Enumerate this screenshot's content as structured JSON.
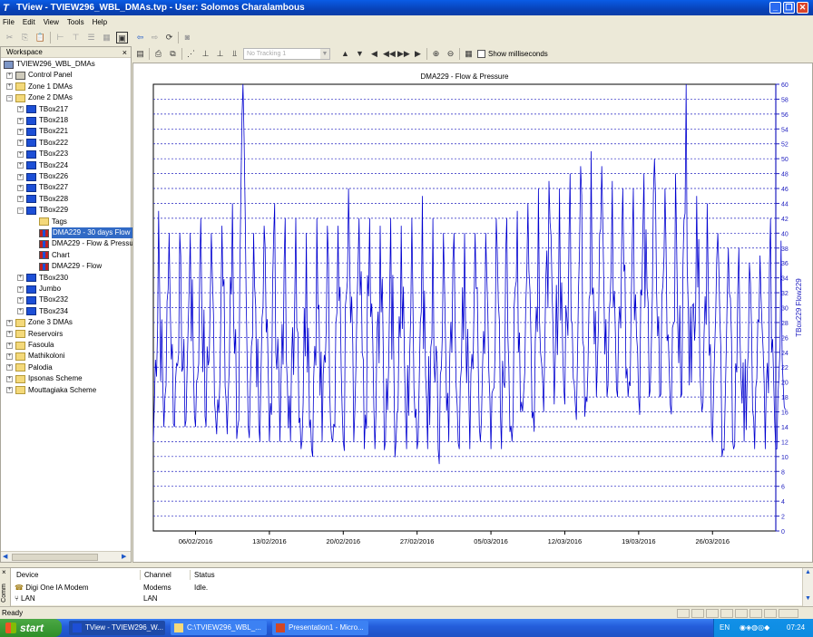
{
  "window": {
    "title": "TView - TVIEW296_WBL_DMAs.tvp - User: Solomos Charalambous",
    "app_icon": "T"
  },
  "menu": [
    "File",
    "Edit",
    "View",
    "Tools",
    "Help"
  ],
  "toolbar": {
    "tracking_placeholder": "No Tracking 1",
    "show_ms_label": "Show milliseconds"
  },
  "workspace": {
    "header": "Workspace",
    "close": "×",
    "tree": [
      {
        "label": "TVIEW296_WBL_DMAs",
        "level": 0,
        "icon": "root",
        "expander": ""
      },
      {
        "label": "Control Panel",
        "level": 1,
        "icon": "control",
        "expander": "+"
      },
      {
        "label": "Zone 1 DMAs",
        "level": 1,
        "icon": "folder",
        "expander": "+"
      },
      {
        "label": "Zone 2 DMAs",
        "level": 1,
        "icon": "folder",
        "expander": "−"
      },
      {
        "label": "TBox217",
        "level": 2,
        "icon": "tbox",
        "expander": "+"
      },
      {
        "label": "TBox218",
        "level": 2,
        "icon": "tbox",
        "expander": "+"
      },
      {
        "label": "TBox221",
        "level": 2,
        "icon": "tbox",
        "expander": "+"
      },
      {
        "label": "TBox222",
        "level": 2,
        "icon": "tbox",
        "expander": "+"
      },
      {
        "label": "TBox223",
        "level": 2,
        "icon": "tbox",
        "expander": "+"
      },
      {
        "label": "TBox224",
        "level": 2,
        "icon": "tbox",
        "expander": "+"
      },
      {
        "label": "TBox226",
        "level": 2,
        "icon": "tbox",
        "expander": "+"
      },
      {
        "label": "TBox227",
        "level": 2,
        "icon": "tbox",
        "expander": "+"
      },
      {
        "label": "TBox228",
        "level": 2,
        "icon": "tbox",
        "expander": "+"
      },
      {
        "label": "TBox229",
        "level": 2,
        "icon": "tbox",
        "expander": "−"
      },
      {
        "label": "Tags",
        "level": 3,
        "icon": "folder",
        "expander": ""
      },
      {
        "label": "DMA229 - 30 days Flow (",
        "level": 3,
        "icon": "chart",
        "expander": "",
        "selected": true
      },
      {
        "label": "DMA229 - Flow & Pressur",
        "level": 3,
        "icon": "chart",
        "expander": ""
      },
      {
        "label": "Chart",
        "level": 3,
        "icon": "chart",
        "expander": ""
      },
      {
        "label": "DMA229 - Flow",
        "level": 3,
        "icon": "chart",
        "expander": ""
      },
      {
        "label": "TBox230",
        "level": 2,
        "icon": "tbox",
        "expander": "+"
      },
      {
        "label": "Jumbo",
        "level": 2,
        "icon": "tbox",
        "expander": "+"
      },
      {
        "label": "TBox232",
        "level": 2,
        "icon": "tbox",
        "expander": "+"
      },
      {
        "label": "TBox234",
        "level": 2,
        "icon": "tbox",
        "expander": "+"
      },
      {
        "label": "Zone 3 DMAs",
        "level": 1,
        "icon": "folder",
        "expander": "+"
      },
      {
        "label": "Reservoirs",
        "level": 1,
        "icon": "folder",
        "expander": "+"
      },
      {
        "label": "Fasoula",
        "level": 1,
        "icon": "folder",
        "expander": "+"
      },
      {
        "label": "Mathikoloni",
        "level": 1,
        "icon": "folder",
        "expander": "+"
      },
      {
        "label": "Palodia",
        "level": 1,
        "icon": "folder",
        "expander": "+"
      },
      {
        "label": "Ipsonas Scheme",
        "level": 1,
        "icon": "folder",
        "expander": "+"
      },
      {
        "label": "Mouttagiaka Scheme",
        "level": 1,
        "icon": "folder",
        "expander": "+"
      }
    ]
  },
  "chart_data": {
    "type": "line",
    "title": "DMA229 - Flow & Pressure",
    "ylabel": "TBox229 Flow229",
    "ylim": [
      0,
      60
    ],
    "yticks": [
      0,
      2,
      4,
      6,
      8,
      10,
      12,
      14,
      16,
      18,
      20,
      22,
      24,
      26,
      28,
      30,
      32,
      34,
      36,
      38,
      40,
      42,
      44,
      46,
      48,
      50,
      52,
      54,
      56,
      58,
      60
    ],
    "xticks": [
      "06/02/2016",
      "13/02/2016",
      "20/02/2016",
      "27/02/2016",
      "05/03/2016",
      "12/03/2016",
      "19/03/2016",
      "26/03/2016"
    ],
    "xrange_days": [
      0,
      59
    ],
    "xtick_days": [
      4,
      11,
      18,
      25,
      32,
      39,
      46,
      53
    ],
    "series": [
      {
        "name": "TBox229 Flow229",
        "color": "#0000d0",
        "daily_min": [
          12,
          14,
          14,
          14,
          14,
          14,
          13,
          13,
          14,
          14,
          14,
          12,
          12,
          12,
          11,
          11,
          12,
          12,
          12,
          12,
          11,
          11,
          12,
          12,
          11,
          11,
          11,
          11,
          12,
          11,
          11,
          12,
          11,
          11,
          12,
          16,
          16,
          16,
          17,
          17,
          17,
          18,
          18,
          18,
          18,
          18,
          18,
          18,
          18,
          17,
          18,
          20,
          16,
          12,
          11,
          11,
          12,
          11,
          11,
          11
        ],
        "daily_max": [
          43,
          40,
          40,
          40,
          42,
          40,
          41,
          44,
          60,
          40,
          41,
          44,
          42,
          42,
          40,
          42,
          41,
          41,
          46,
          42,
          42,
          41,
          42,
          41,
          42,
          45,
          42,
          40,
          40,
          40,
          40,
          40,
          42,
          42,
          43,
          44,
          46,
          47,
          46,
          48,
          49,
          51,
          49,
          47,
          46,
          46,
          48,
          50,
          46,
          48,
          60,
          45,
          44,
          40,
          38,
          38,
          36,
          37,
          42,
          39
        ]
      }
    ],
    "grid": true
  },
  "comms": {
    "side_label": "Comm",
    "columns": [
      "Device",
      "Channel",
      "Status"
    ],
    "rows": [
      {
        "device": "Digi One IA Modem",
        "channel": "Modems",
        "status": "Idle."
      },
      {
        "device": "LAN",
        "channel": "LAN",
        "status": ""
      }
    ]
  },
  "status": {
    "text": "Ready"
  },
  "taskbar": {
    "start": "start",
    "tasks": [
      {
        "label": "TView - TVIEW296_W...",
        "active": true
      },
      {
        "label": "C:\\TVIEW296_WBL_...",
        "active": false
      },
      {
        "label": "Presentation1 - Micro...",
        "active": false
      }
    ],
    "lang": "EN",
    "clock": "07:24"
  }
}
